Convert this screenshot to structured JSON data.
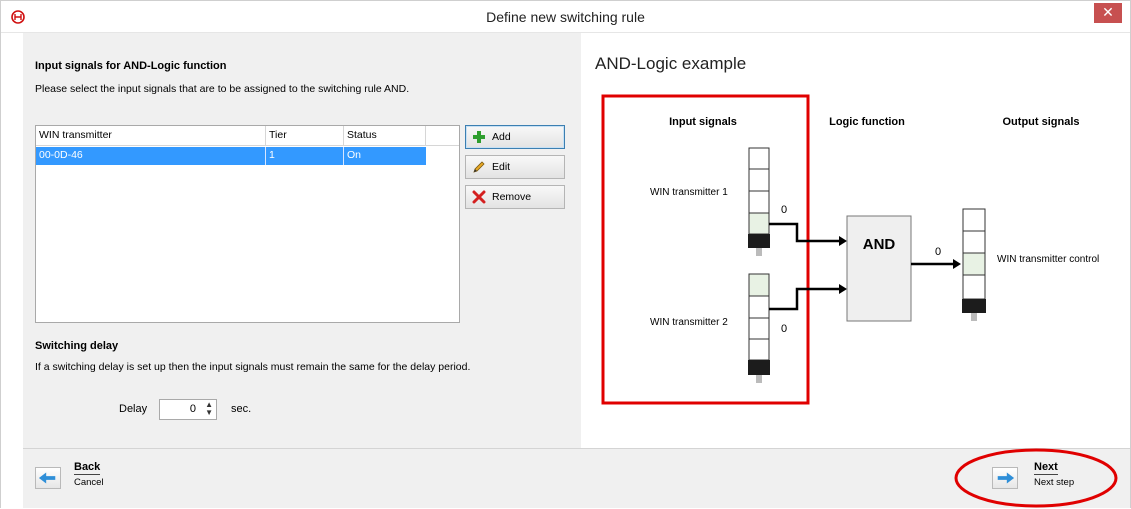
{
  "window": {
    "title": "Define new switching rule",
    "close_glyph": "✕"
  },
  "input_section": {
    "heading": "Input signals for AND-Logic function",
    "description": "Please select the input signals that are to be assigned to the switching rule AND.",
    "table": {
      "columns": [
        "WIN transmitter",
        "Tier",
        "Status"
      ],
      "rows": [
        {
          "transmitter": "00-0D-46",
          "tier": "1",
          "status": "On"
        }
      ]
    },
    "buttons": {
      "add": "Add",
      "edit": "Edit",
      "remove": "Remove"
    }
  },
  "delay_section": {
    "heading": "Switching delay",
    "description": "If a switching delay is set up then the input signals must remain the same for the delay period.",
    "label": "Delay",
    "value": "0",
    "unit": "sec."
  },
  "example": {
    "title": "AND-Logic example",
    "col_input": "Input signals",
    "col_logic": "Logic function",
    "col_output": "Output signals",
    "transmitter1": "WIN transmitter 1",
    "transmitter2": "WIN transmitter 2",
    "value1": "0",
    "value2": "0",
    "gate": "AND",
    "gate_out": "0",
    "output_label": "WIN transmitter control"
  },
  "footer": {
    "back_label": "Back",
    "back_sub": "Cancel",
    "next_label": "Next",
    "next_sub": "Next step"
  },
  "colors": {
    "highlight_red": "#e00000",
    "selection_blue": "#3399ff",
    "arrow_blue": "#2f8fd8"
  },
  "icons": {
    "app": "brand-logo-icon",
    "add": "plus-icon",
    "edit": "pencil-icon",
    "remove": "remove-x-icon",
    "back": "arrow-left-icon",
    "next": "arrow-right-icon"
  }
}
